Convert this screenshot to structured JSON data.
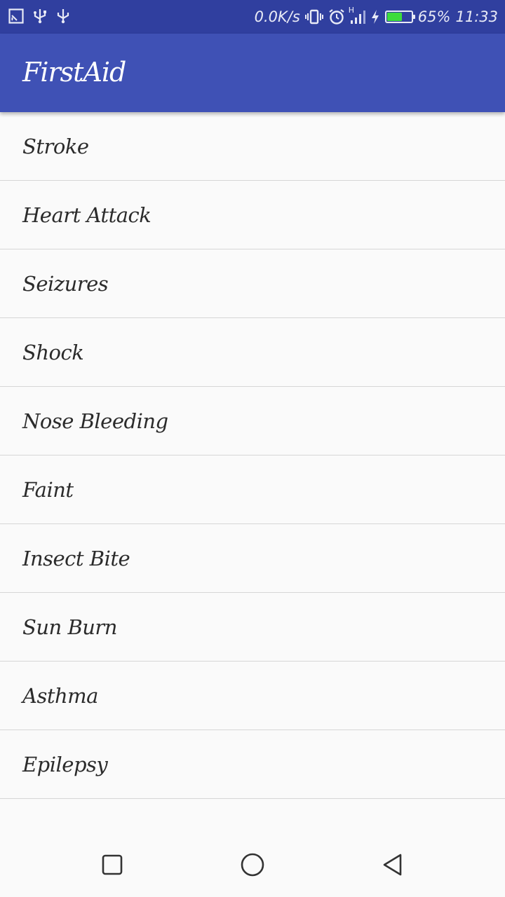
{
  "status_bar": {
    "left_icons": [
      "screen-cast-icon",
      "usb-icon",
      "usb-icon"
    ],
    "network_speed": "0.0K/s",
    "network_type": "H",
    "battery_level": 0.65,
    "battery_percent": "65%",
    "time": "11:33",
    "battery_color": "#3ddc3d"
  },
  "app_bar": {
    "title": "FirstAid",
    "color": "#3f51b5"
  },
  "topics": [
    {
      "label": "Stroke"
    },
    {
      "label": "Heart Attack"
    },
    {
      "label": "Seizures"
    },
    {
      "label": "Shock"
    },
    {
      "label": "Nose Bleeding"
    },
    {
      "label": "Faint"
    },
    {
      "label": "Insect Bite"
    },
    {
      "label": "Sun Burn"
    },
    {
      "label": "Asthma"
    },
    {
      "label": "Epilepsy"
    }
  ],
  "nav_bar": {
    "icons": [
      "recents-square-icon",
      "home-circle-icon",
      "back-triangle-icon"
    ]
  }
}
